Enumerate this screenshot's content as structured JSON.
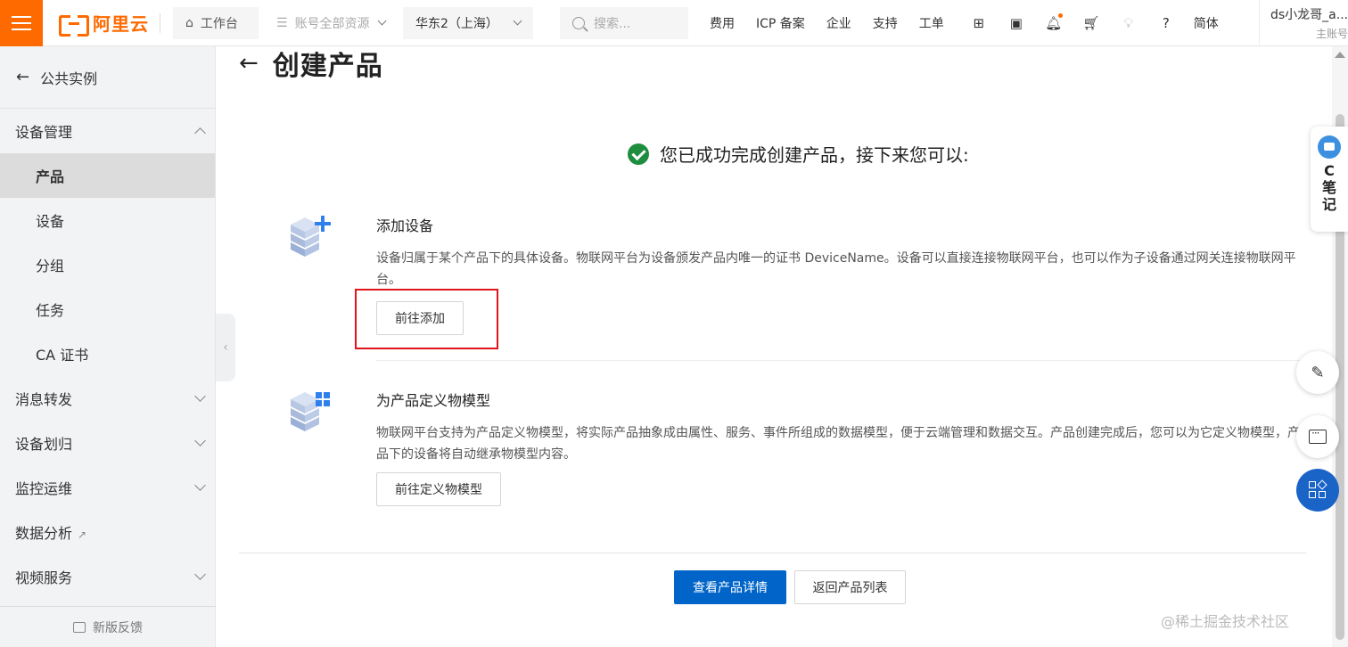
{
  "topbar": {
    "logo_text": "阿里云",
    "workbench": "工作台",
    "resource_scope": "账号全部资源",
    "region": "华东2（上海）",
    "search_placeholder": "搜索...",
    "links": [
      "费用",
      "ICP 备案",
      "企业",
      "支持",
      "工单"
    ],
    "lang": "简体",
    "user_name": "ds小龙哥_a...",
    "user_role": "主账号"
  },
  "sidebar": {
    "back_label": "公共实例",
    "groups": [
      {
        "label": "设备管理",
        "expanded": true,
        "items": [
          "产品",
          "设备",
          "分组",
          "任务",
          "CA 证书"
        ]
      },
      {
        "label": "消息转发"
      },
      {
        "label": "设备划归"
      },
      {
        "label": "监控运维"
      },
      {
        "label": "数据分析"
      },
      {
        "label": "视频服务"
      }
    ],
    "feedback": "新版反馈"
  },
  "page": {
    "title": "创建产品",
    "success_msg": "您已成功完成创建产品，接下来您可以:",
    "steps": [
      {
        "title": "添加设备",
        "desc": "设备归属于某个产品下的具体设备。物联网平台为设备颁发产品内唯一的证书 DeviceName。设备可以直接连接物联网平台，也可以作为子设备通过网关连接物联网平台。",
        "button": "前往添加"
      },
      {
        "title": "为产品定义物模型",
        "desc": "物联网平台支持为产品定义物模型，将实际产品抽象成由属性、服务、事件所组成的数据模型，便于云端管理和数据交互。产品创建完成后，您可以为它定义物模型，产品下的设备将自动继承物模型内容。",
        "button": "前往定义物模型"
      }
    ],
    "primary_button": "查看产品详情",
    "secondary_button": "返回产品列表"
  },
  "floating": {
    "note_label": "C笔记"
  },
  "watermark": "@稀土掘金技术社区",
  "colors": {
    "brand": "#ff6a00",
    "primary": "#0064c8",
    "success": "#1e8e3e",
    "highlight": "#e0141b"
  }
}
